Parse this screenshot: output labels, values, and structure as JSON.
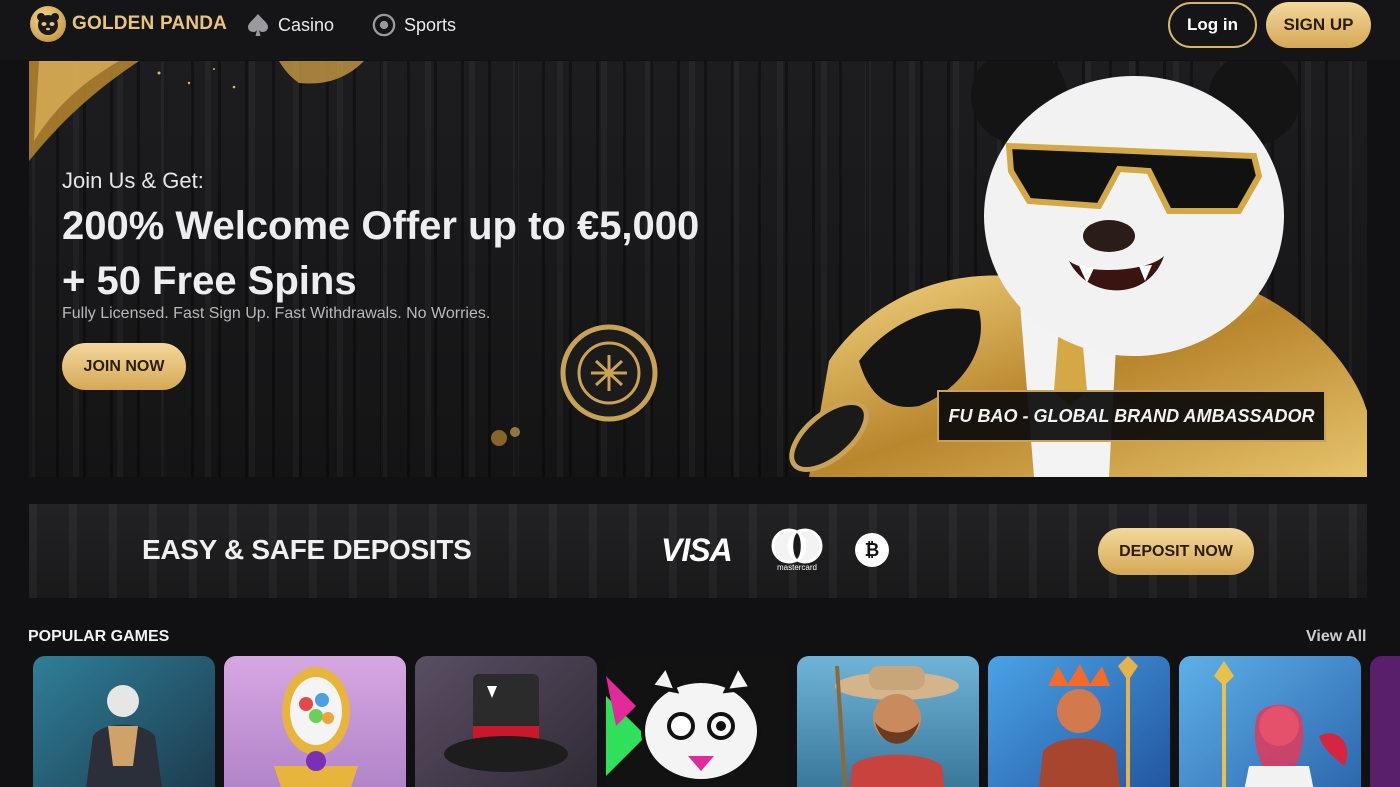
{
  "header": {
    "logo_text": "GOLDEN PANDA",
    "nav": [
      {
        "label": "Casino",
        "icon": "spade-icon"
      },
      {
        "label": "Sports",
        "icon": "soccer-ball-icon"
      }
    ],
    "login_label": "Log in",
    "signup_label": "SIGN UP"
  },
  "hero": {
    "kicker": "Join Us & Get:",
    "title_line1": "200% Welcome Offer up to €5,000",
    "title_line2": "+ 50 Free Spins",
    "subtitle": "Fully Licensed. Fast Sign Up. Fast Withdrawals. No Worries.",
    "cta_label": "JOIN NOW",
    "ambassador_label": "FU BAO - GLOBAL BRAND AMBASSADOR"
  },
  "deposit": {
    "title": "EASY & SAFE DEPOSITS",
    "visa": "VISA",
    "mastercard": "mastercard",
    "bitcoin": "₿",
    "cta_label": "DEPOSIT NOW"
  },
  "games": {
    "title": "POPULAR GAMES",
    "view_all": "View All",
    "tiles": [
      {
        "name": "game-tile-1",
        "bg": "#2b5c6e"
      },
      {
        "name": "game-tile-2",
        "bg": "#b98bd0"
      },
      {
        "name": "game-tile-3",
        "bg": "#4a4152"
      },
      {
        "name": "game-tile-4",
        "bg": "#1a1a1a"
      },
      {
        "name": "game-tile-5",
        "bg": "#3b6f8c"
      },
      {
        "name": "game-tile-6",
        "bg": "#2f7dc4"
      },
      {
        "name": "game-tile-7",
        "bg": "#3f86c6"
      },
      {
        "name": "game-tile-8",
        "bg": "#5a1f6a"
      }
    ]
  },
  "colors": {
    "gold": "#d6a856",
    "gold_light": "#f3d89c",
    "background": "#111113"
  }
}
